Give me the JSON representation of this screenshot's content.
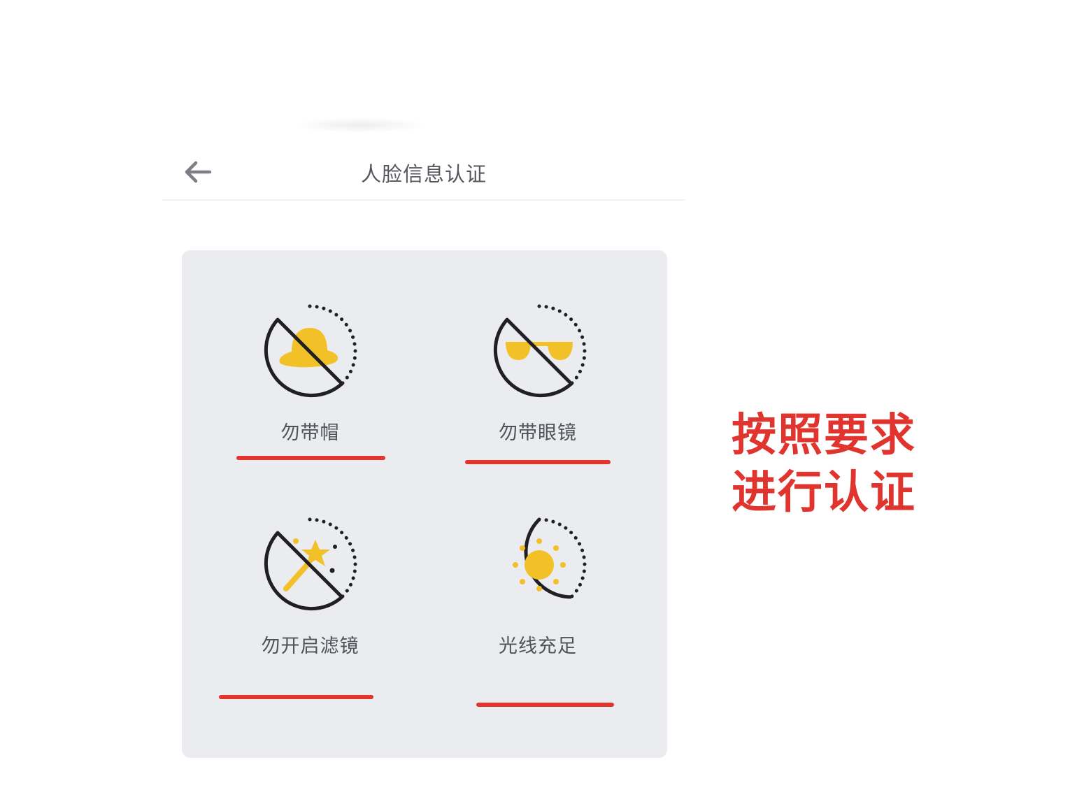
{
  "header": {
    "back_icon": "arrow-left-icon",
    "title": "人脸信息认证"
  },
  "tips": [
    {
      "label": "勿带帽",
      "icon": "no-hat-icon"
    },
    {
      "label": "勿带眼镜",
      "icon": "no-glasses-icon"
    },
    {
      "label": "勿开启滤镜",
      "icon": "no-filter-icon"
    },
    {
      "label": "光线充足",
      "icon": "sun-icon"
    }
  ],
  "annotation": {
    "line1": "按照要求",
    "line2": "进行认证"
  },
  "colors": {
    "panel_background": "#ebecf0",
    "icon_stroke": "#1f1f24",
    "icon_accent": "#f2c027",
    "highlight_red": "#e2332c",
    "title_text": "#55575e"
  }
}
